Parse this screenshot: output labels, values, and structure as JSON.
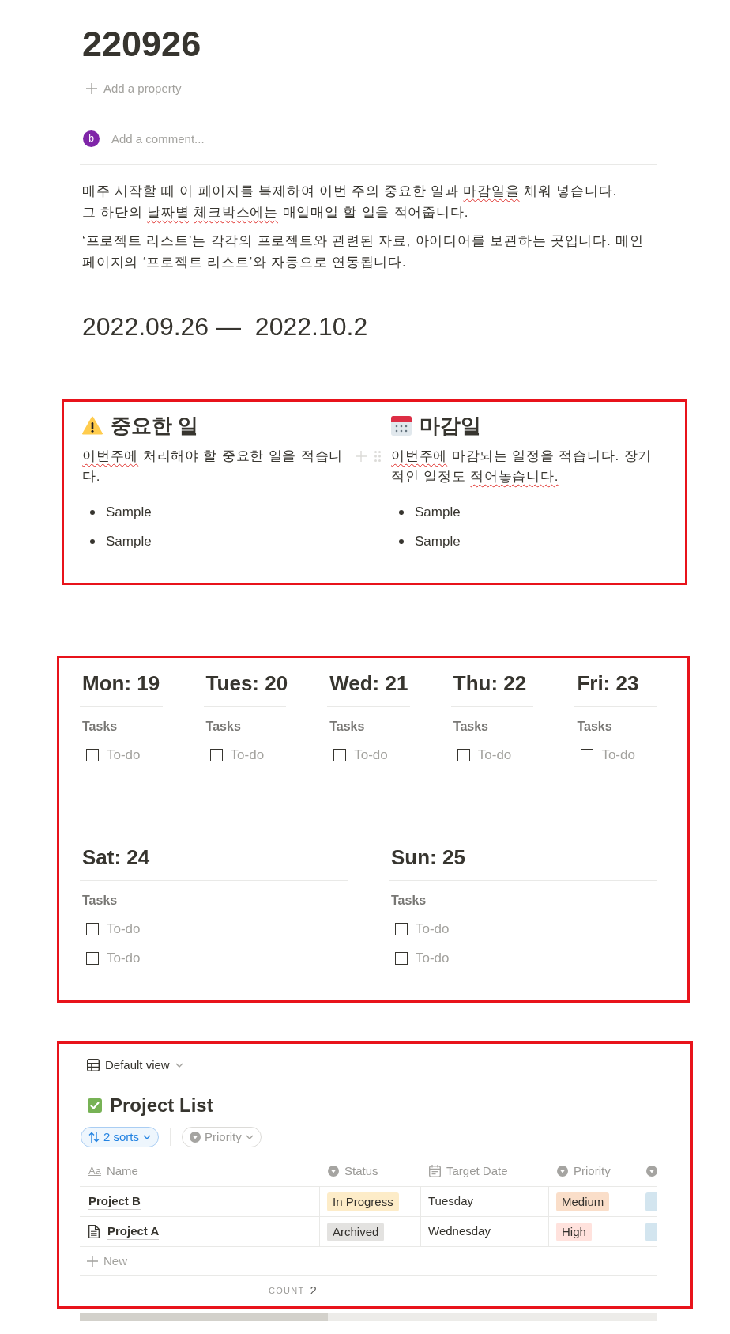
{
  "title": "220926",
  "property_button": {
    "label": "Add a property"
  },
  "comment": {
    "avatar": "b",
    "placeholder": "Add a comment..."
  },
  "intro": [
    {
      "lines": [
        [
          {
            "text": "매주 시작할 때 이 페이지를 복제하여 이번 주의 중요한 일과 ",
            "misspelled": false
          },
          {
            "text": "마감일을",
            "misspelled": true
          },
          {
            "text": " 채워 넣습니다.",
            "misspelled": false
          }
        ],
        [
          {
            "text": "그 하단의 ",
            "misspelled": false
          },
          {
            "text": "날짜별 체크박스에는",
            "misspelled": true
          },
          {
            "text": " 매일매일 할 일을 적어줍니다.",
            "misspelled": false
          }
        ]
      ]
    },
    {
      "lines": [
        [
          {
            "text": "‘프로젝트 리스트’는 각각의 프로젝트와 관련된 자료, 아이디어를 보관하는 곳입니다. 메인 페이지의 ‘프로젝트 리스트’와 자동으로 연동됩니다.",
            "misspelled": false
          }
        ]
      ]
    }
  ],
  "date_heading": "2022.09.26 —  2022.10.2",
  "priorities": {
    "highlighted": true,
    "columns": [
      {
        "kind": "important",
        "heading": "중요한 일",
        "hovered": false,
        "description": [
          {
            "text": "이번주에",
            "misspelled": true
          },
          {
            "text": " 처리해야 할 중요한 일을 적습니다.",
            "misspelled": false
          }
        ],
        "items": [
          "Sample",
          "Sample"
        ]
      },
      {
        "kind": "deadline",
        "heading": "마감일",
        "hovered": true,
        "description": [
          {
            "text": "이번주에",
            "misspelled": true
          },
          {
            "text": " 마감되는 일정을 적습니다. 장기적인 일정도 ",
            "misspelled": false
          },
          {
            "text": "적어놓습니다.",
            "misspelled": true
          }
        ],
        "items": [
          "Sample",
          "Sample"
        ]
      }
    ]
  },
  "week": {
    "highlighted": true,
    "rows": [
      {
        "days": [
          {
            "heading": "Mon: 19",
            "section": "Tasks",
            "todos": [
              {
                "placeholder": "To-do",
                "checked": false
              }
            ]
          },
          {
            "heading": "Tues: 20",
            "section": "Tasks",
            "todos": [
              {
                "placeholder": "To-do",
                "checked": false
              }
            ]
          },
          {
            "heading": "Wed: 21",
            "section": "Tasks",
            "todos": [
              {
                "placeholder": "To-do",
                "checked": false
              }
            ]
          },
          {
            "heading": "Thu: 22",
            "section": "Tasks",
            "todos": [
              {
                "placeholder": "To-do",
                "checked": false
              }
            ]
          },
          {
            "heading": "Fri: 23",
            "section": "Tasks",
            "todos": [
              {
                "placeholder": "To-do",
                "checked": false
              }
            ]
          }
        ]
      },
      {
        "days": [
          {
            "heading": "Sat: 24",
            "section": "Tasks",
            "todos": [
              {
                "placeholder": "To-do",
                "checked": false
              },
              {
                "placeholder": "To-do",
                "checked": false
              }
            ]
          },
          {
            "heading": "Sun: 25",
            "section": "Tasks",
            "todos": [
              {
                "placeholder": "To-do",
                "checked": false
              },
              {
                "placeholder": "To-do",
                "checked": false
              }
            ]
          }
        ]
      }
    ]
  },
  "database": {
    "highlighted": true,
    "view": "Default view",
    "title": "Project List",
    "filters": [
      {
        "kind": "sort",
        "label": "2 sorts",
        "active": true
      },
      {
        "kind": "property",
        "label": "Priority",
        "active": false
      }
    ],
    "columns": [
      {
        "kind": "title",
        "icon_text": "Aa",
        "label": "Name"
      },
      {
        "kind": "select",
        "label": "Status"
      },
      {
        "kind": "date",
        "label": "Target Date"
      },
      {
        "kind": "select",
        "label": "Priority"
      },
      {
        "kind": "select"
      }
    ],
    "rows": [
      {
        "page_icon": false,
        "name": "Project B",
        "status": {
          "label": "In Progress",
          "color": "#fdecc8"
        },
        "target_date": "Tuesday",
        "priority": {
          "label": "Medium",
          "color": "#fadec9"
        },
        "column_5": {
          "color": "#d3e5ef"
        }
      },
      {
        "page_icon": true,
        "name": "Project A",
        "status": {
          "label": "Archived",
          "color": "#e3e2e0"
        },
        "target_date": "Wednesday",
        "priority": {
          "label": "High",
          "color": "#ffe2dd"
        },
        "column_5": {
          "color": "#d3e5ef"
        }
      }
    ],
    "new_button": "New",
    "footer": {
      "label": "COUNT",
      "value": "2"
    }
  }
}
